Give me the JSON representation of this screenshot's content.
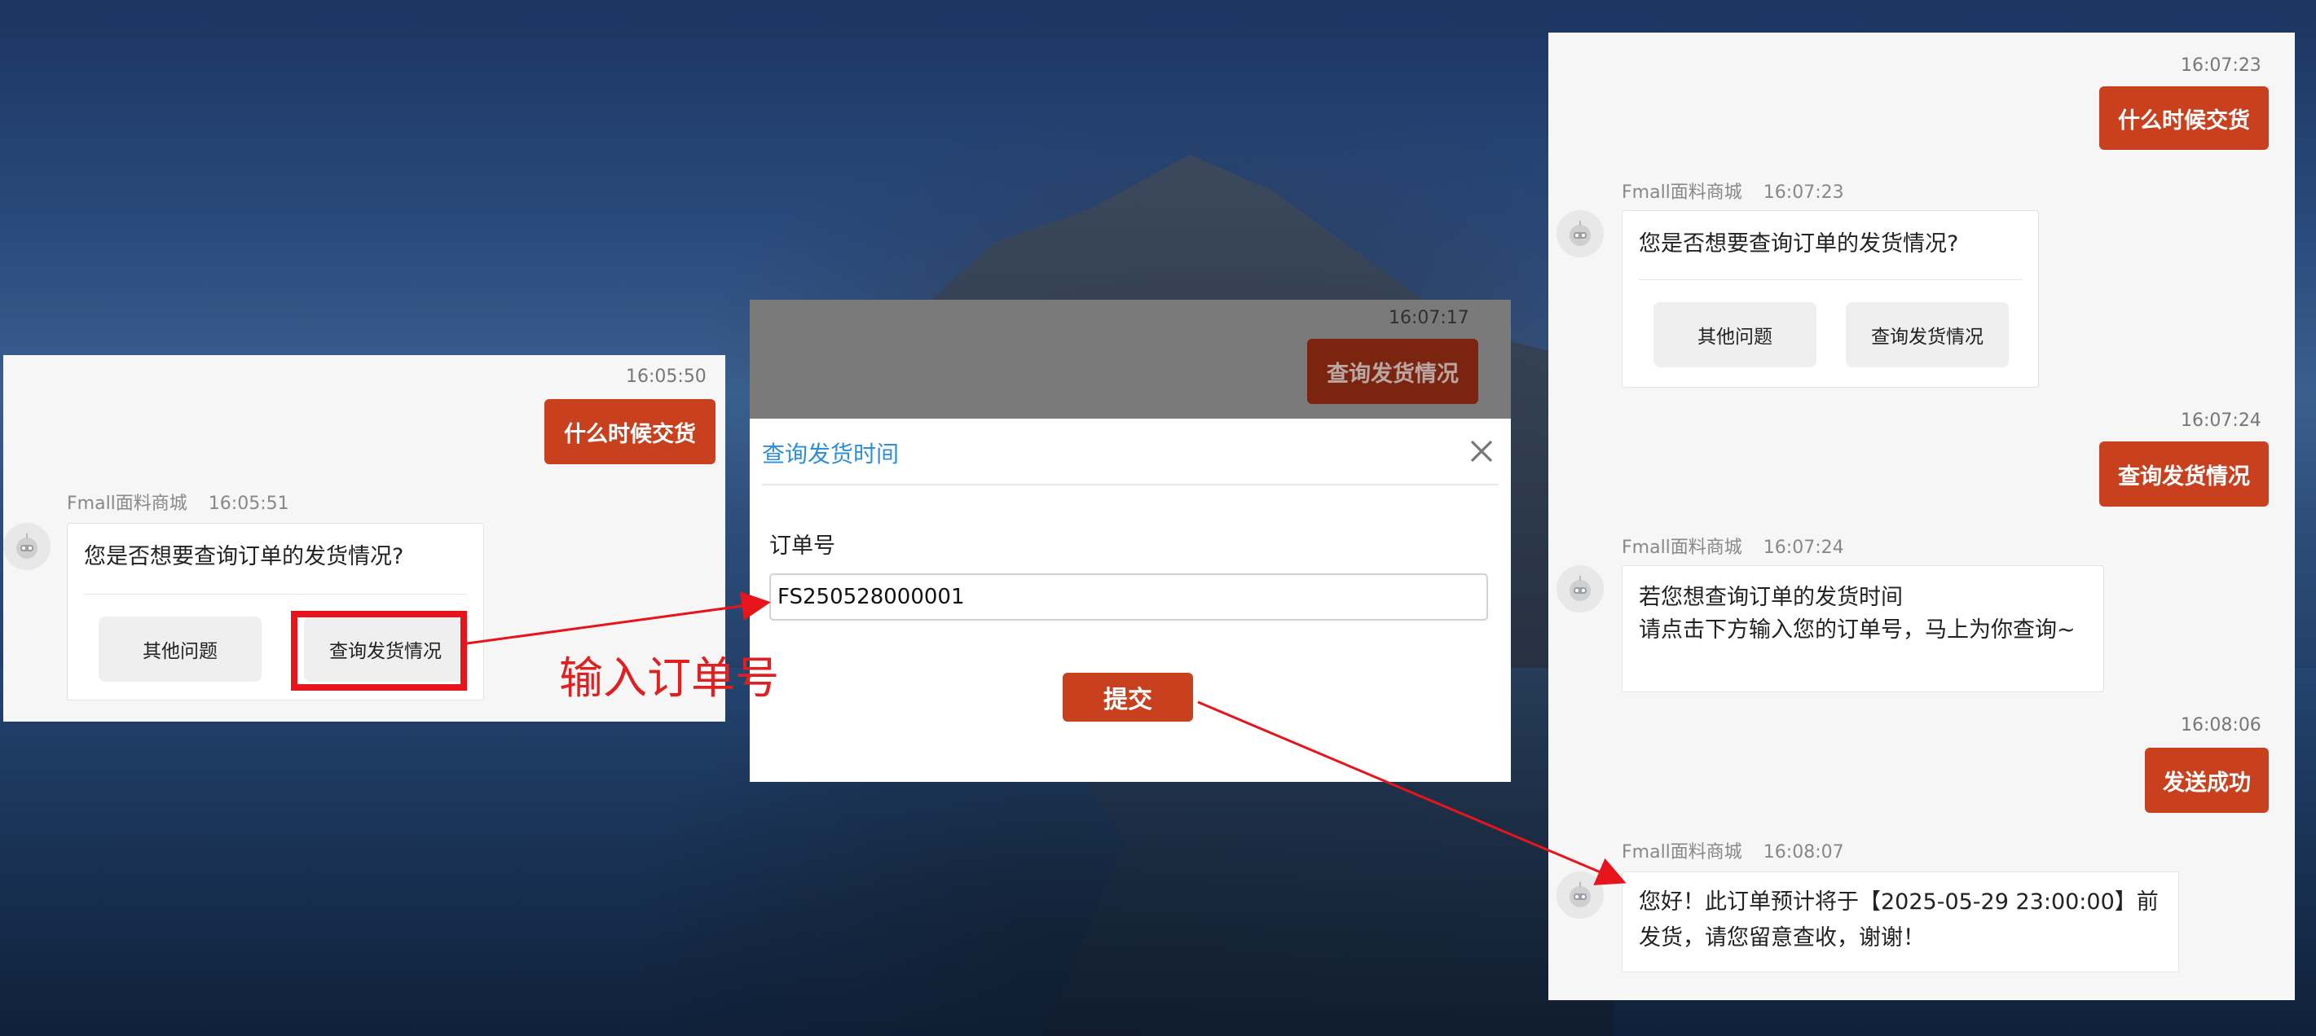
{
  "left_panel": {
    "time_user": "16:05:50",
    "user_msg": "什么时候交货",
    "sender_name": "Fmall面料商城",
    "sender_time": "16:05:51",
    "question": "您是否想要查询订单的发货情况?",
    "btn_other": "其他问题",
    "btn_query": "查询发货情况"
  },
  "mid_panel": {
    "time_user": "16:07:17",
    "user_msg": "查询发货情况"
  },
  "dialog": {
    "title": "查询发货时间",
    "field_label": "订单号",
    "order_value": "FS250528000001",
    "submit_label": "提交"
  },
  "annotation": {
    "text": "输入订单号",
    "color": "#e02020"
  },
  "right_panel": {
    "t1": "16:07:23",
    "msg1": "什么时候交货",
    "sender1_name": "Fmall面料商城",
    "sender1_time": "16:07:23",
    "question": "您是否想要查询订单的发货情况?",
    "btn_other": "其他问题",
    "btn_query": "查询发货情况",
    "t2": "16:07:24",
    "msg2": "查询发货情况",
    "sender2_name": "Fmall面料商城",
    "sender2_time": "16:07:24",
    "reply2_line1": "若您想查询订单的发货时间",
    "reply2_line2": "请点击下方输入您的订单号，马上为你查询~",
    "t3": "16:08:06",
    "msg3": "发送成功",
    "sender3_name": "Fmall面料商城",
    "sender3_time": "16:08:07",
    "reply3_line1": "您好！此订单预计将于【2025-05-29 23:00:00】前",
    "reply3_line2": "发货，请您留意查收，谢谢！"
  },
  "colors": {
    "accent": "#c9401f",
    "link_blue": "#2d8fd8",
    "annotation_red": "#e8141c"
  },
  "icons": [
    "robot-avatar-icon",
    "close-icon",
    "arrow-icon"
  ]
}
